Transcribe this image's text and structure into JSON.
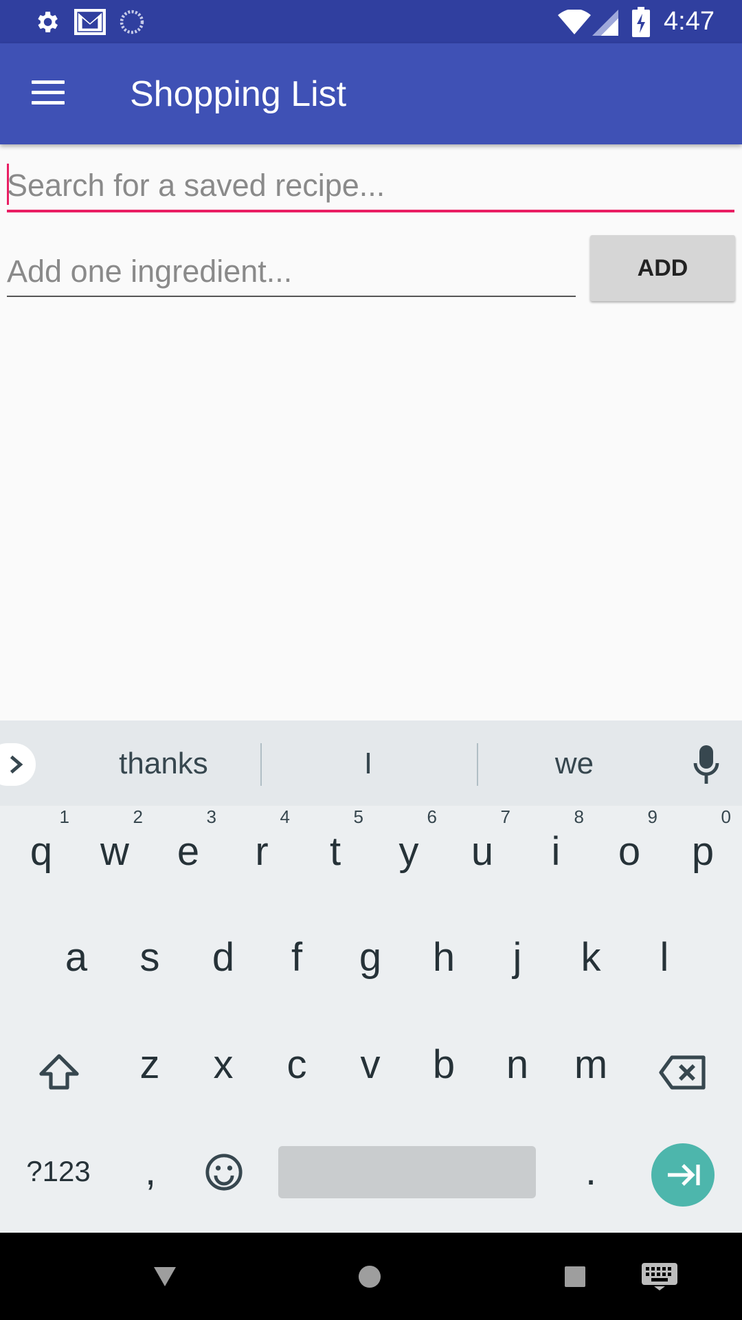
{
  "status_bar": {
    "time": "4:47",
    "icons": [
      "settings-icon",
      "gmail-icon",
      "sync-icon",
      "wifi-icon",
      "signal-icon",
      "battery-charging-icon"
    ]
  },
  "app_bar": {
    "title": "Shopping List",
    "menu_icon": "hamburger-menu-icon"
  },
  "search": {
    "placeholder": "Search for a saved recipe...",
    "value": ""
  },
  "ingredient": {
    "placeholder": "Add one ingredient...",
    "value": ""
  },
  "add_button": {
    "label": "ADD"
  },
  "keyboard": {
    "suggestions": [
      "thanks",
      "I",
      "we"
    ],
    "row1": [
      {
        "key": "q",
        "hint": "1"
      },
      {
        "key": "w",
        "hint": "2"
      },
      {
        "key": "e",
        "hint": "3"
      },
      {
        "key": "r",
        "hint": "4"
      },
      {
        "key": "t",
        "hint": "5"
      },
      {
        "key": "y",
        "hint": "6"
      },
      {
        "key": "u",
        "hint": "7"
      },
      {
        "key": "i",
        "hint": "8"
      },
      {
        "key": "o",
        "hint": "9"
      },
      {
        "key": "p",
        "hint": "0"
      }
    ],
    "row2": [
      "a",
      "s",
      "d",
      "f",
      "g",
      "h",
      "j",
      "k",
      "l"
    ],
    "row3": [
      "z",
      "x",
      "c",
      "v",
      "b",
      "n",
      "m"
    ],
    "symbols_key": "?123",
    "comma_key": ",",
    "period_key": "."
  },
  "colors": {
    "status_bar": "#303f9f",
    "app_bar": "#3f51b5",
    "accent": "#e91e63",
    "enter_key": "#4db6ac"
  }
}
